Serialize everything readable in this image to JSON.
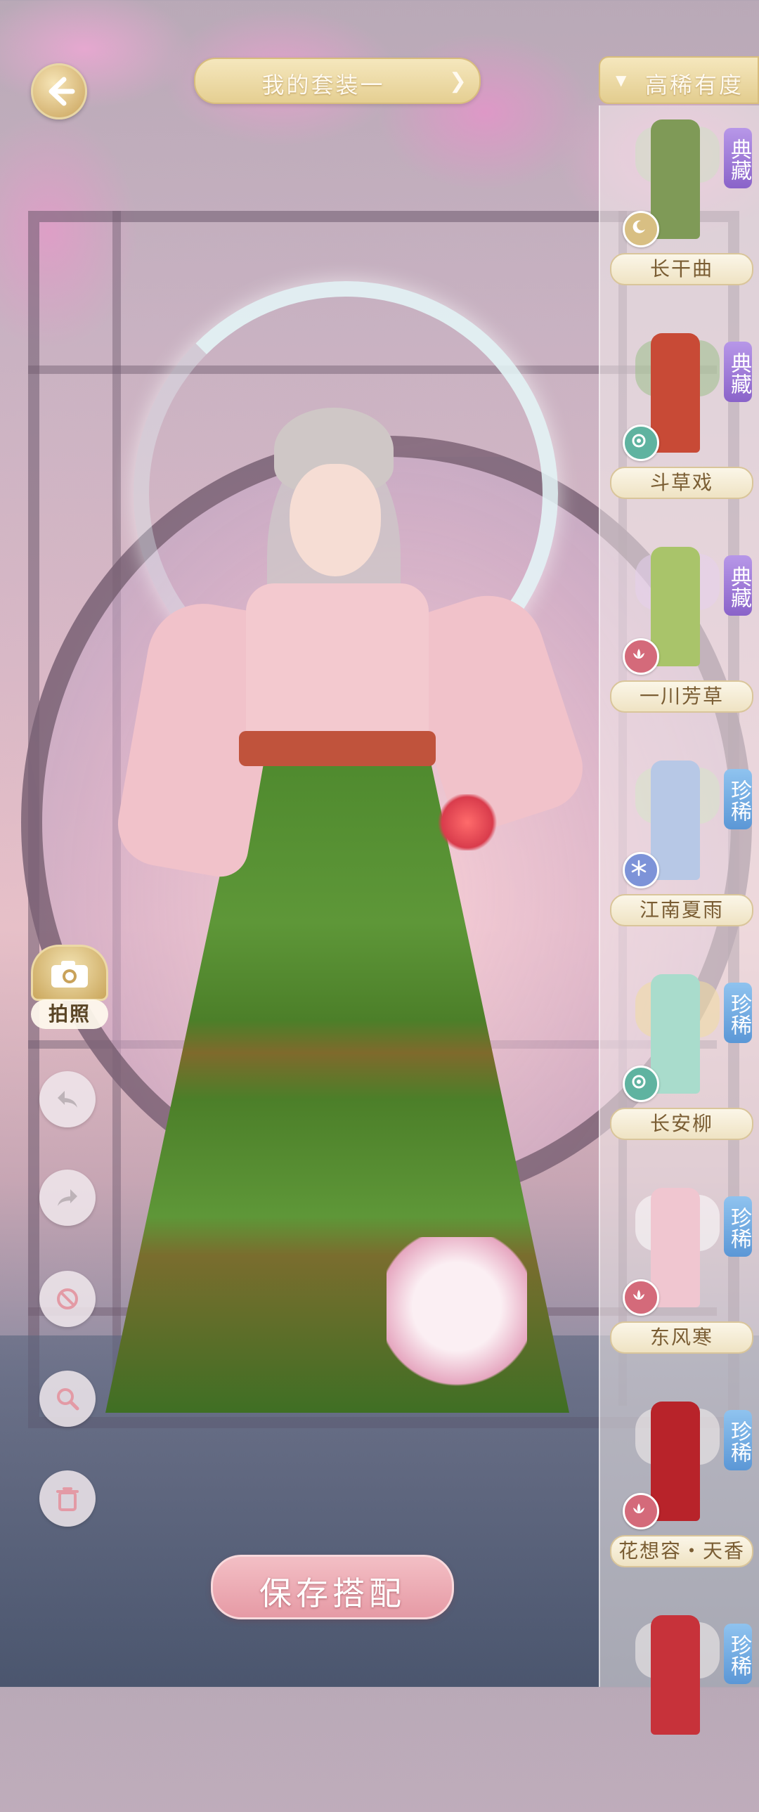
{
  "header": {
    "outfit_title": "我的套装一",
    "sort_label": "高稀有度"
  },
  "wardrobe": {
    "items": [
      {
        "name": "长干曲",
        "rarity": "典藏",
        "badge": "moon-icon",
        "color": "#7f9a57"
      },
      {
        "name": "斗草戏",
        "rarity": "典藏",
        "badge": "swirl-icon",
        "color": "#c84a36"
      },
      {
        "name": "一川芳草",
        "rarity": "典藏",
        "badge": "lotus-icon",
        "color": "#a9c46a"
      },
      {
        "name": "江南夏雨",
        "rarity": "珍稀",
        "badge": "snowflake-icon",
        "color": "#b7c8e6"
      },
      {
        "name": "长安柳",
        "rarity": "珍稀",
        "badge": "swirl-icon",
        "color": "#a9dccc"
      },
      {
        "name": "东风寒",
        "rarity": "珍稀",
        "badge": "lotus-icon",
        "color": "#f0c6d0"
      },
      {
        "name": "花想容・天香",
        "rarity": "珍稀",
        "badge": "lotus-icon",
        "color": "#b8232a"
      },
      {
        "name": "",
        "rarity": "珍稀",
        "badge": "",
        "color": "#c7323a"
      }
    ]
  },
  "tools": {
    "camera_label": "拍照"
  },
  "actions": {
    "save_label": "保存搭配"
  },
  "colors": {
    "gold": "#e5cf92",
    "rarity_dianzang": "#8a63c9",
    "rarity_zhenxi": "#5b97d6",
    "save_pink": "#e69aa5"
  }
}
